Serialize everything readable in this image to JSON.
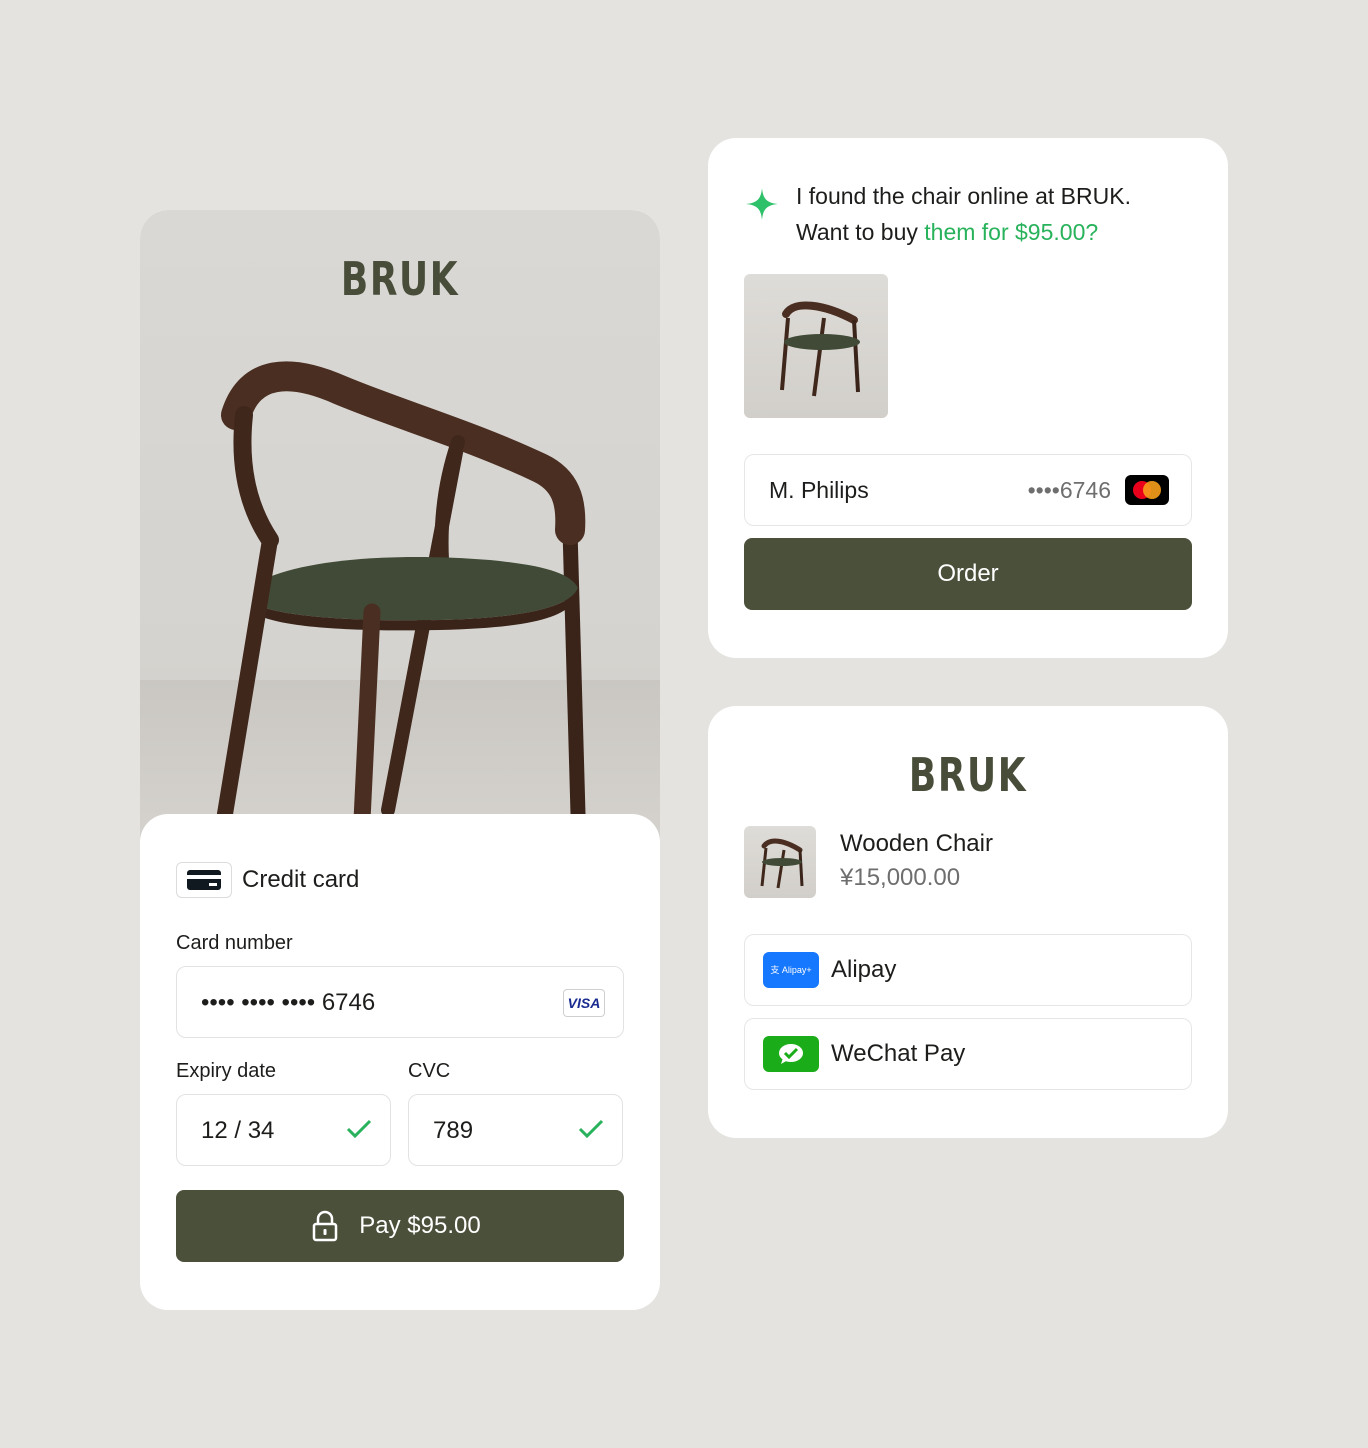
{
  "colors": {
    "background": "#e5e3df",
    "primary_button": "#4b503a",
    "brand_text": "#474d38",
    "accent_green": "#28b25b",
    "alipay_blue": "#1677ff",
    "wechat_green": "#1aad19"
  },
  "product_card": {
    "brand": "BRUK",
    "payment_method": {
      "icon": "credit-card-icon",
      "title": "Credit card"
    },
    "card_number": {
      "label": "Card number",
      "value": "•••• •••• •••• 6746",
      "brand_badge": "VISA"
    },
    "expiry": {
      "label": "Expiry date",
      "value": "12 / 34"
    },
    "cvc": {
      "label": "CVC",
      "value": "789"
    },
    "pay_button": {
      "label": "Pay $95.00",
      "icon": "lock-icon"
    }
  },
  "chat_card": {
    "icon": "sparkle-icon",
    "message_line1": "I found the chair online at BRUK.",
    "message_line2_prefix": "Want to buy ",
    "message_line2_highlight": "them for $95.00?",
    "payer_name": "M. Philips",
    "card_digits": "••••6746",
    "card_brand_icon": "mastercard-icon",
    "order_button": "Order"
  },
  "checkout_card": {
    "brand": "BRUK",
    "item_name": "Wooden Chair",
    "item_price": "¥15,000.00",
    "methods": [
      {
        "label": "Alipay",
        "logo_text": "支 Alipay+"
      },
      {
        "label": "WeChat Pay",
        "logo": "wechat-icon"
      }
    ]
  }
}
